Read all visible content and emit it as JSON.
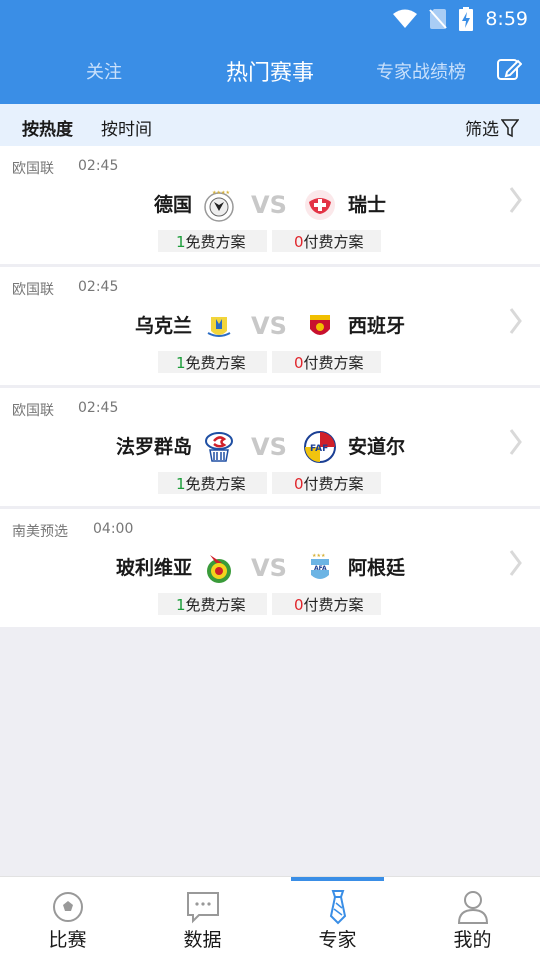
{
  "status_bar": {
    "time": "8:59"
  },
  "header": {
    "follow_tab": "关注",
    "title": "热门赛事",
    "ranking_tab": "专家战绩榜",
    "edit_icon": "edit-icon"
  },
  "sort_bar": {
    "by_heat": "按热度",
    "by_time": "按时间",
    "filter": "筛选"
  },
  "matches": [
    {
      "league": "欧国联",
      "time": "02:45",
      "home": "德国",
      "away": "瑞士",
      "vs": "VS",
      "free_count": "1",
      "free_label": "免费方案",
      "paid_count": "0",
      "paid_label": "付费方案"
    },
    {
      "league": "欧国联",
      "time": "02:45",
      "home": "乌克兰",
      "away": "西班牙",
      "vs": "VS",
      "free_count": "1",
      "free_label": "免费方案",
      "paid_count": "0",
      "paid_label": "付费方案"
    },
    {
      "league": "欧国联",
      "time": "02:45",
      "home": "法罗群岛",
      "away": "安道尔",
      "vs": "VS",
      "free_count": "1",
      "free_label": "免费方案",
      "paid_count": "0",
      "paid_label": "付费方案"
    },
    {
      "league": "南美预选",
      "time": "04:00",
      "home": "玻利维亚",
      "away": "阿根廷",
      "vs": "VS",
      "free_count": "1",
      "free_label": "免费方案",
      "paid_count": "0",
      "paid_label": "付费方案"
    }
  ],
  "tabs": [
    {
      "label": "比赛",
      "icon": "soccer-ball-icon"
    },
    {
      "label": "数据",
      "icon": "chat-bubble-icon"
    },
    {
      "label": "专家",
      "icon": "tie-icon"
    },
    {
      "label": "我的",
      "icon": "person-icon"
    }
  ],
  "colors": {
    "accent": "#3a8ee6",
    "free": "#1c9d3a",
    "paid": "#e0262c"
  }
}
